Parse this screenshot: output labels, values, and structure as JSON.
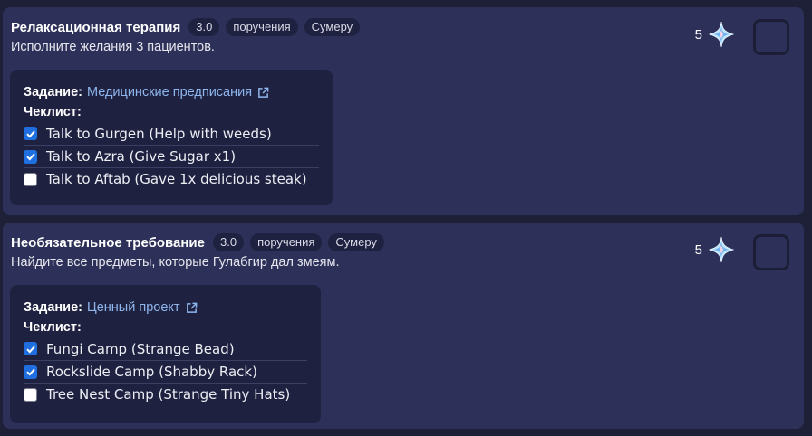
{
  "colors": {
    "page_bg": "#1e2038",
    "card_bg": "#2d3058",
    "panel_bg": "#1f2140",
    "link": "#8fb7ee",
    "checkbox_accent": "#1f6fe0"
  },
  "cards": [
    {
      "title": "Релаксационная терапия",
      "badges": [
        "3.0",
        "поручения",
        "Сумеру"
      ],
      "description": "Исполните желания 3 пациентов.",
      "reward": {
        "count": "5",
        "icon": "primogem-icon"
      },
      "quest_label": "Задание:",
      "quest_name": "Медицинские предписания",
      "checklist_label": "Чеклист:",
      "checklist": [
        {
          "text": "Talk to Gurgen (Help with weeds)",
          "checked": true
        },
        {
          "text": "Talk to Azra (Give Sugar x1)",
          "checked": true
        },
        {
          "text": "Talk to Aftab (Gave 1x delicious steak)",
          "checked": false
        }
      ],
      "completed": false
    },
    {
      "title": "Необязательное требование",
      "badges": [
        "3.0",
        "поручения",
        "Сумеру"
      ],
      "description": "Найдите все предметы, которые Гулабгир дал змеям.",
      "reward": {
        "count": "5",
        "icon": "primogem-icon"
      },
      "quest_label": "Задание:",
      "quest_name": "Ценный проект",
      "checklist_label": "Чеклист:",
      "checklist": [
        {
          "text": "Fungi Camp (Strange Bead)",
          "checked": true
        },
        {
          "text": "Rockslide Camp (Shabby Rack)",
          "checked": true
        },
        {
          "text": "Tree Nest Camp (Strange Tiny Hats)",
          "checked": false
        }
      ],
      "completed": false
    }
  ]
}
